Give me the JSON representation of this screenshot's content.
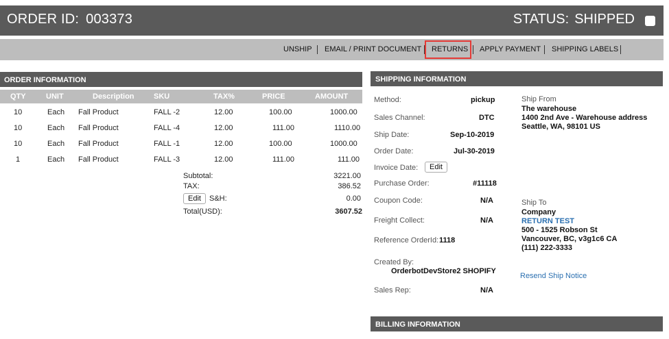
{
  "header": {
    "order_id_label": "ORDER ID:",
    "order_id": "003373",
    "status_label": "STATUS:",
    "status": "SHIPPED"
  },
  "toolbar": {
    "actions": [
      "UNSHIP",
      "EMAIL / PRINT DOCUMENT",
      "RETURNS",
      "APPLY PAYMENT",
      "SHIPPING LABELS"
    ]
  },
  "order": {
    "title": "ORDER INFORMATION",
    "columns": [
      "QTY",
      "UNIT",
      "Description",
      "SKU",
      "TAX%",
      "PRICE",
      "AMOUNT"
    ],
    "rows": [
      [
        "10",
        "Each",
        "Fall Product",
        "FALL -2",
        "12.00",
        "100.00",
        "1000.00"
      ],
      [
        "10",
        "Each",
        "Fall Product",
        "FALL -4",
        "12.00",
        "111.00",
        "1110.00"
      ],
      [
        "10",
        "Each",
        "Fall Product",
        "FALL -1",
        "12.00",
        "100.00",
        "1000.00"
      ],
      [
        "1",
        "Each",
        "Fall Product",
        "FALL -3",
        "12.00",
        "111.00",
        "111.00"
      ]
    ],
    "summary": {
      "subtotal_label": "Subtotal:",
      "subtotal": "3221.00",
      "tax_label": "TAX:",
      "tax": "386.52",
      "edit_label": "Edit",
      "sh_label": "S&H:",
      "sh": "0.00",
      "total_label": "Total(USD):",
      "total": "3607.52"
    }
  },
  "shipping": {
    "title": "SHIPPING INFORMATION",
    "method_label": "Method:",
    "method": "pickup",
    "channel_label": "Sales Channel:",
    "channel": "DTC",
    "ship_date_label": "Ship Date:",
    "ship_date": "Sep-10-2019",
    "order_date_label": "Order Date:",
    "order_date": "Jul-30-2019",
    "invoice_date_label": "Invoice Date:",
    "invoice_edit": "Edit",
    "po_label": "Purchase Order:",
    "po": "#11118",
    "coupon_label": "Coupon Code:",
    "coupon": "N/A",
    "freight_label": "Freight Collect:",
    "freight": "N/A",
    "ref_label": "Reference OrderId:",
    "ref": "1118",
    "created_label": "Created By:",
    "created": "OrderbotDevStore2 SHOPIFY",
    "rep_label": "Sales Rep:",
    "rep": "N/A",
    "ship_from_label": "Ship From",
    "ship_from": [
      "The warehouse",
      "1400 2nd Ave - Warehouse address",
      "Seattle, WA, 98101 US"
    ],
    "ship_to_label": "Ship To",
    "ship_to_company": "Company",
    "ship_to_name": "RETURN TEST",
    "ship_to_lines": [
      "500 - 1525 Robson St",
      "Vancouver, BC, v3g1c6 CA",
      "(111) 222-3333"
    ],
    "resend": "Resend Ship Notice"
  },
  "billing": {
    "title": "BILLING INFORMATION"
  },
  "colors": {
    "header_bg": "#5a5a5a",
    "toolbar_bg": "#bdbdbd",
    "highlight": "#e53935",
    "link": "#2a6fb0"
  }
}
